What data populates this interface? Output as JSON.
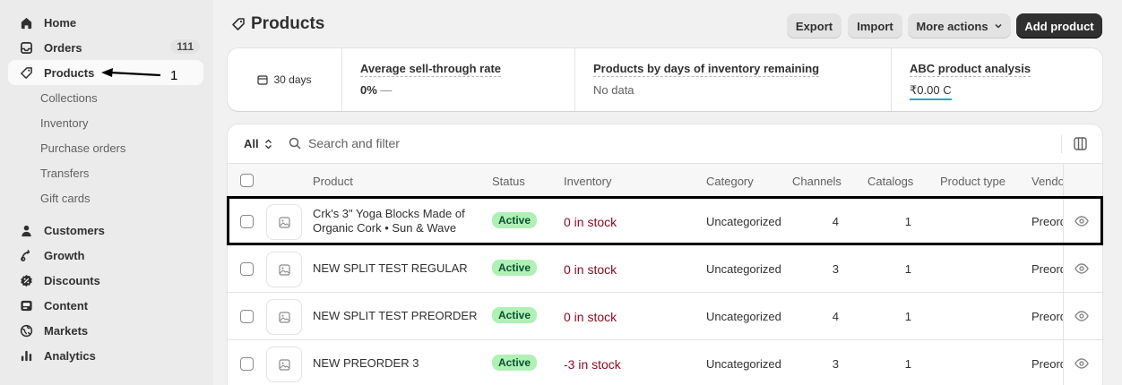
{
  "sidebar": {
    "items": [
      {
        "label": "Home",
        "icon": "home-icon"
      },
      {
        "label": "Orders",
        "icon": "orders-icon",
        "badge": "111"
      },
      {
        "label": "Products",
        "icon": "tag-icon",
        "active": true
      },
      {
        "label": "Customers",
        "icon": "person-icon"
      },
      {
        "label": "Growth",
        "icon": "growth-icon"
      },
      {
        "label": "Discounts",
        "icon": "discount-icon"
      },
      {
        "label": "Content",
        "icon": "content-icon"
      },
      {
        "label": "Markets",
        "icon": "globe-icon"
      },
      {
        "label": "Analytics",
        "icon": "bar-chart-icon"
      }
    ],
    "sub_items": [
      "Collections",
      "Inventory",
      "Purchase orders",
      "Transfers",
      "Gift cards"
    ]
  },
  "annotation": {
    "number": "1"
  },
  "header": {
    "title": "Products",
    "export": "Export",
    "import": "Import",
    "more_actions": "More actions",
    "add_product": "Add product"
  },
  "stats": {
    "period": "30 days",
    "sell_through_title": "Average sell-through rate",
    "sell_through_value": "0%",
    "sell_through_trend": "—",
    "days_inventory_title": "Products by days of inventory remaining",
    "days_inventory_value": "No data",
    "abc_title": "ABC product analysis",
    "abc_value": "₹0.00",
    "abc_grade": "C"
  },
  "filter": {
    "tab": "All",
    "search_placeholder": "Search and filter"
  },
  "table": {
    "columns": [
      "Product",
      "Status",
      "Inventory",
      "Category",
      "Channels",
      "Catalogs",
      "Product type",
      "Vendor"
    ],
    "rows": [
      {
        "name": "Crk's 3\" Yoga Blocks Made of Organic Cork • Sun & Wave",
        "status": "Active",
        "inventory": "0 in stock",
        "category": "Uncategorized",
        "channels": "4",
        "catalogs": "1",
        "type": "",
        "vendor": "Preorder"
      },
      {
        "name": "NEW SPLIT TEST REGULAR",
        "status": "Active",
        "inventory": "0 in stock",
        "category": "Uncategorized",
        "channels": "3",
        "catalogs": "1",
        "type": "",
        "vendor": "Preorder"
      },
      {
        "name": "NEW SPLIT TEST PREORDER",
        "status": "Active",
        "inventory": "0 in stock",
        "category": "Uncategorized",
        "channels": "4",
        "catalogs": "1",
        "type": "",
        "vendor": "Preorder"
      },
      {
        "name": "NEW PREORDER 3",
        "status": "Active",
        "inventory": "-3 in stock",
        "category": "Uncategorized",
        "channels": "3",
        "catalogs": "1",
        "type": "",
        "vendor": "Preorder"
      }
    ]
  }
}
